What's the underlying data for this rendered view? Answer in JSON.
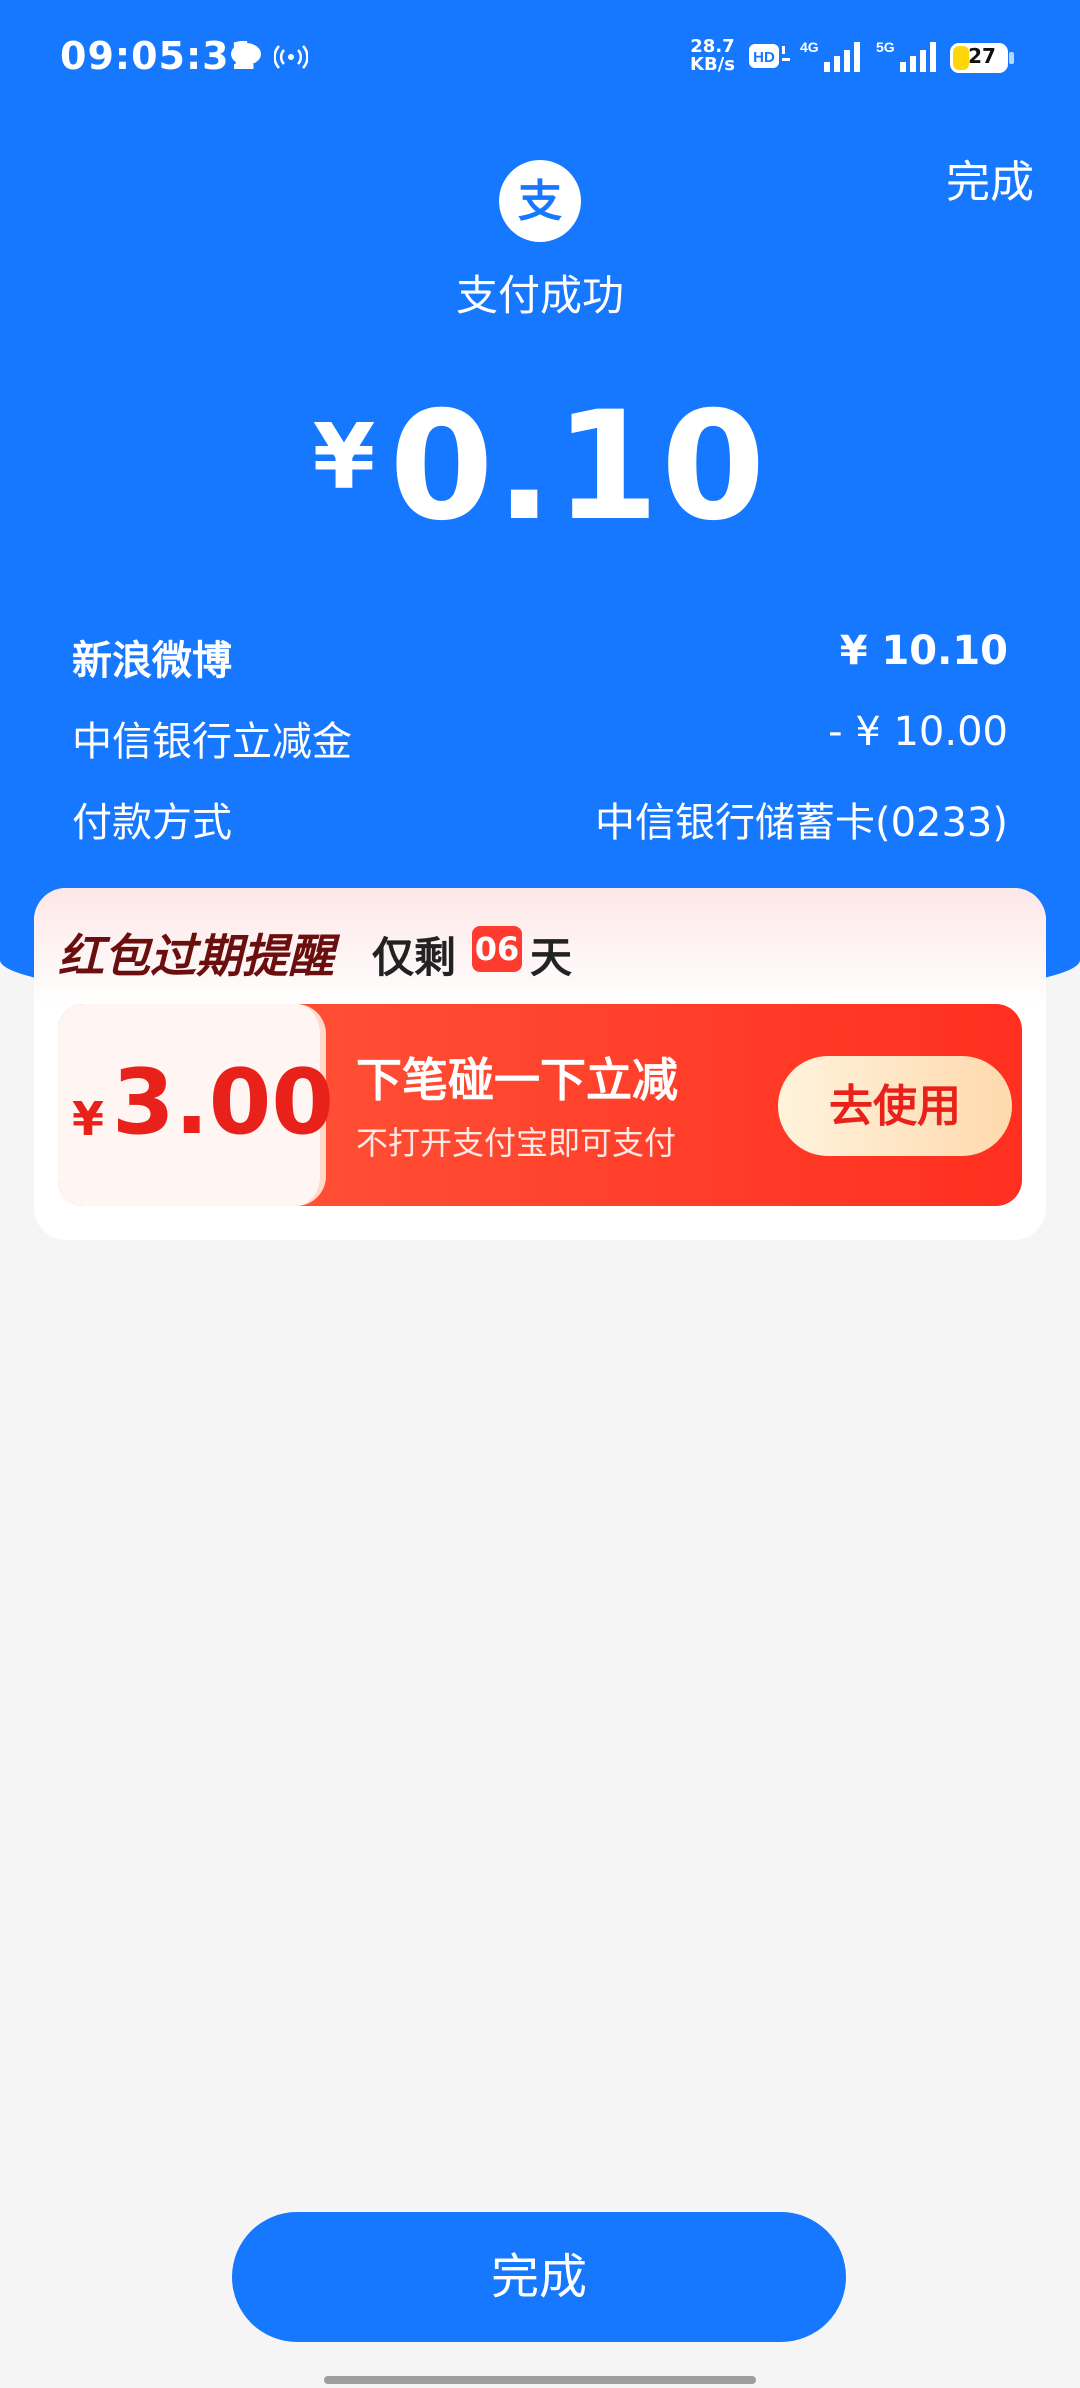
{
  "status_bar": {
    "time": "09:05:31",
    "net_speed_top": "28.7",
    "net_speed_bottom": "KB/s",
    "battery": "27",
    "icons": [
      "chat-bubble-icon",
      "broadcast-icon",
      "hd-voice-icon",
      "signal-4g-icon",
      "signal-5g-icon",
      "battery-icon"
    ]
  },
  "header": {
    "done_label": "完成",
    "logo_glyph": "支",
    "title": "支付成功"
  },
  "amount": {
    "currency": "¥",
    "value": "0.10"
  },
  "details": [
    {
      "key": "新浪微博",
      "value": "¥ 10.10",
      "bold": true
    },
    {
      "key": "中信银行立减金",
      "value": "- ¥ 10.00",
      "bold": false
    },
    {
      "key": "付款方式",
      "value": "中信银行储蓄卡(0233)",
      "bold": false
    }
  ],
  "promo": {
    "title": "红包过期提醒",
    "remaining_prefix": "仅剩",
    "days": "06",
    "days_unit": "天",
    "coupon": {
      "currency": "¥",
      "value": "3.00",
      "title": "下笔碰一下立减",
      "subtitle": "不打开支付宝即可支付",
      "button_label": "去使用"
    }
  },
  "footer": {
    "done_label": "完成"
  },
  "colors": {
    "primary": "#1677ff",
    "coupon_red": "#ff2f1f",
    "accent_red": "#e8221a",
    "background": "#f5f5f5"
  }
}
